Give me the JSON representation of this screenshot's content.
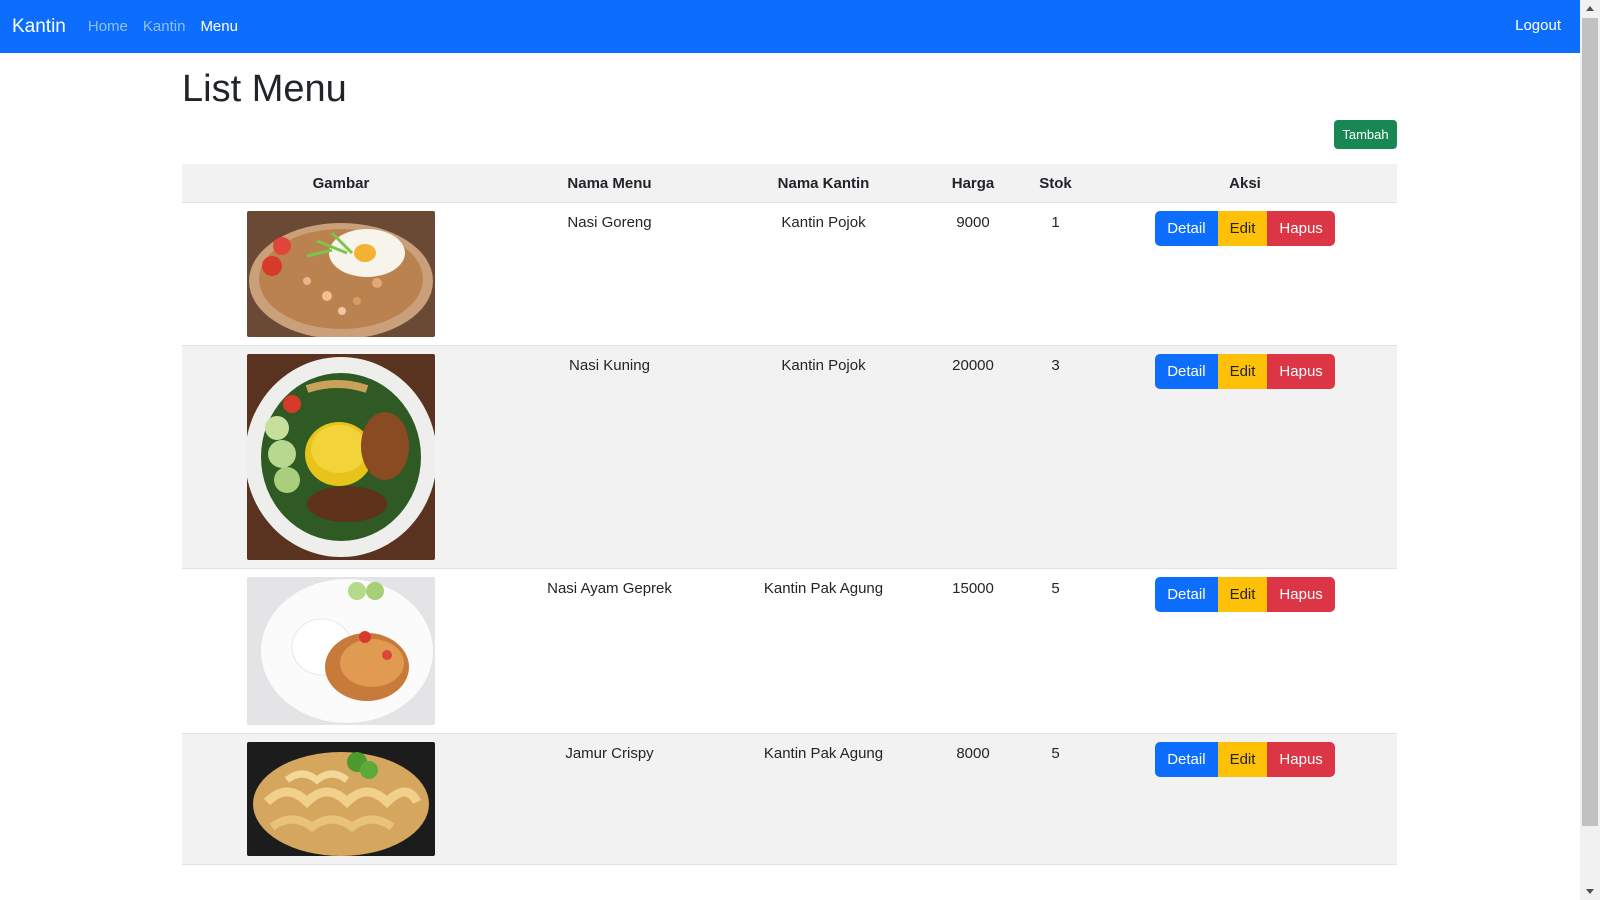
{
  "navbar": {
    "brand": "Kantin",
    "links": [
      {
        "label": "Home",
        "active": false
      },
      {
        "label": "Kantin",
        "active": false
      },
      {
        "label": "Menu",
        "active": true
      }
    ],
    "logout": "Logout",
    "color": "#0d6efd"
  },
  "page": {
    "title": "List Menu",
    "add_button": "Tambah"
  },
  "table": {
    "headers": [
      "Gambar",
      "Nama Menu",
      "Nama Kantin",
      "Harga",
      "Stok",
      "Aksi"
    ],
    "rows": [
      {
        "image": "nasi-goreng-photo",
        "nama_menu": "Nasi Goreng",
        "nama_kantin": "Kantin Pojok",
        "harga": "9000",
        "stok": "1"
      },
      {
        "image": "nasi-kuning-photo",
        "nama_menu": "Nasi Kuning",
        "nama_kantin": "Kantin Pojok",
        "harga": "20000",
        "stok": "3"
      },
      {
        "image": "nasi-ayam-geprek-photo",
        "nama_menu": "Nasi Ayam Geprek",
        "nama_kantin": "Kantin Pak Agung",
        "harga": "15000",
        "stok": "5"
      },
      {
        "image": "jamur-crispy-photo",
        "nama_menu": "Jamur Crispy",
        "nama_kantin": "Kantin Pak Agung",
        "harga": "8000",
        "stok": "5"
      }
    ],
    "actions": {
      "detail": "Detail",
      "edit": "Edit",
      "hapus": "Hapus"
    }
  },
  "colors": {
    "primary": "#0d6efd",
    "success": "#198754",
    "warning": "#ffc107",
    "danger": "#dc3545"
  }
}
